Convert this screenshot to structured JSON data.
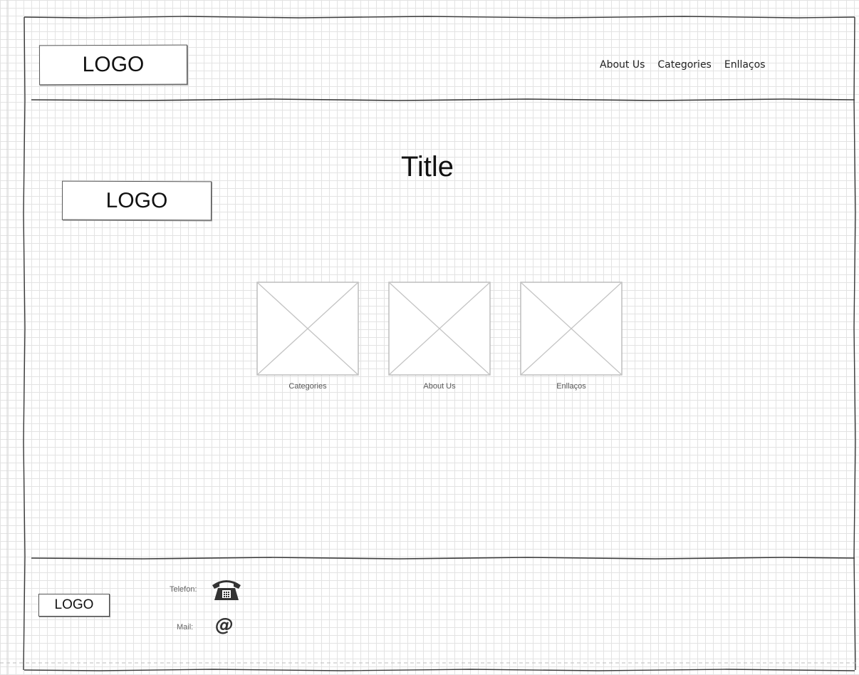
{
  "header": {
    "logo": "LOGO",
    "nav": [
      "About Us",
      "Categories",
      "Enllaços"
    ]
  },
  "hero": {
    "title": "Title",
    "logo": "LOGO"
  },
  "cards": [
    {
      "caption": "Categories"
    },
    {
      "caption": "About Us"
    },
    {
      "caption": "Enllaços"
    }
  ],
  "footer": {
    "logo": "LOGO",
    "phone_label": "Telefon:",
    "phone_icon": "telephone-icon",
    "mail_label": "Mail:",
    "mail_icon": "at-sign-icon",
    "mail_symbol": "@"
  }
}
